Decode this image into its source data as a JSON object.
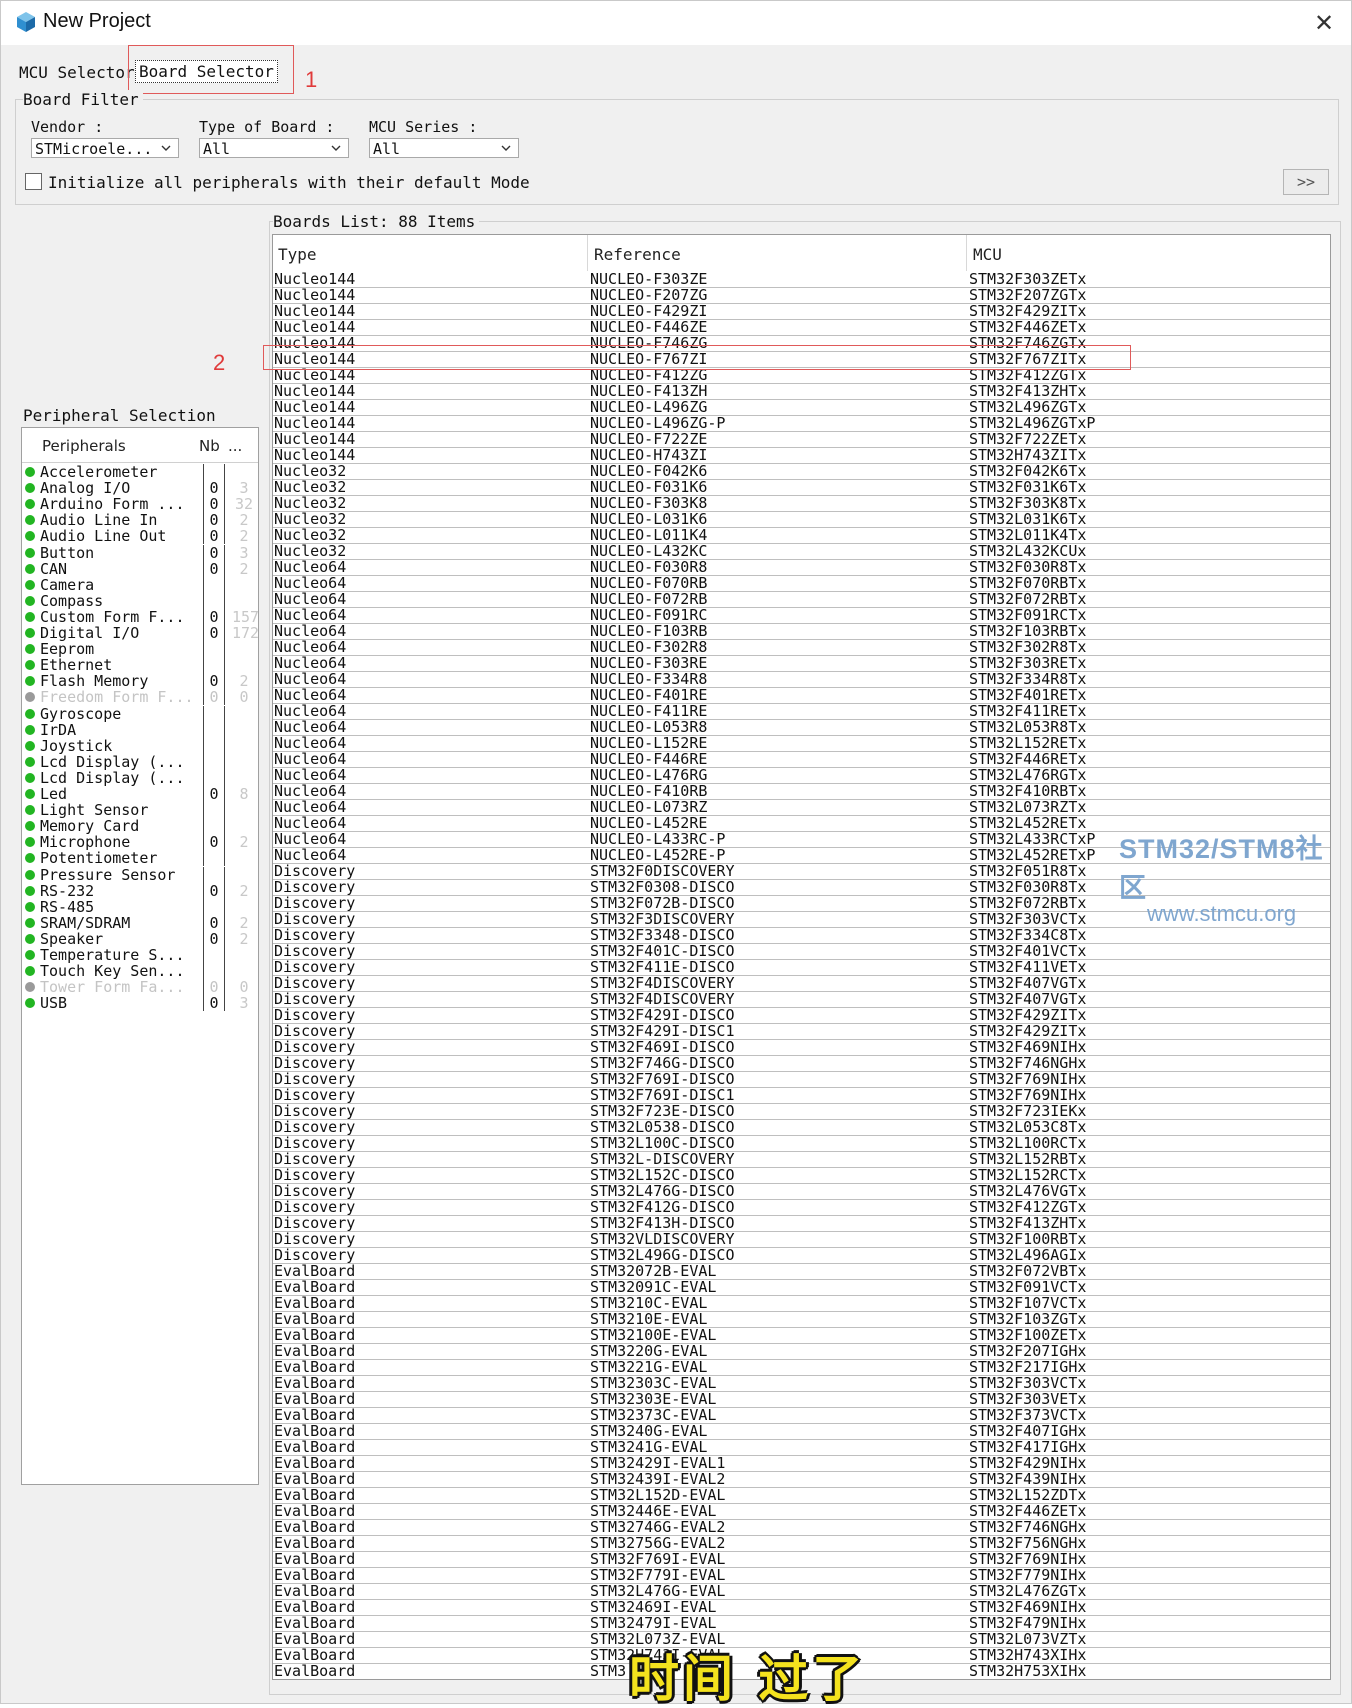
{
  "window": {
    "title": "New Project",
    "close_label": "✕"
  },
  "tabs": {
    "mcu_selector": "MCU Selector",
    "board_selector": "Board Selector"
  },
  "annotations": {
    "one": "1",
    "two": "2"
  },
  "board_filter": {
    "title": "Board Filter",
    "vendor_label": "Vendor :",
    "vendor_value": "STMicroele...",
    "type_label": "Type of Board :",
    "type_value": "All",
    "series_label": "MCU Series :",
    "series_value": "All",
    "init_checkbox_label": "Initialize all peripherals with their default Mode",
    "init_checked": false,
    "expand_button": ">>"
  },
  "peripheral_selection": {
    "title": "Peripheral Selection",
    "headers": [
      "Peripherals",
      "Nb",
      "..."
    ],
    "items": [
      {
        "name": "Accelerometer",
        "nb": "",
        "max": "",
        "enabled": true
      },
      {
        "name": "Analog I/O",
        "nb": "0",
        "max": "3",
        "enabled": true
      },
      {
        "name": "Arduino Form ...",
        "nb": "0",
        "max": "32",
        "enabled": true
      },
      {
        "name": "Audio Line In",
        "nb": "0",
        "max": "2",
        "enabled": true
      },
      {
        "name": "Audio Line Out",
        "nb": "0",
        "max": "2",
        "enabled": true
      },
      {
        "name": "Button",
        "nb": "0",
        "max": "3",
        "enabled": true
      },
      {
        "name": "CAN",
        "nb": "0",
        "max": "2",
        "enabled": true
      },
      {
        "name": "Camera",
        "nb": "",
        "max": "",
        "enabled": true
      },
      {
        "name": "Compass",
        "nb": "",
        "max": "",
        "enabled": true
      },
      {
        "name": "Custom Form F...",
        "nb": "0",
        "max": "157",
        "enabled": true
      },
      {
        "name": "Digital I/O",
        "nb": "0",
        "max": "172",
        "enabled": true
      },
      {
        "name": "Eeprom",
        "nb": "",
        "max": "",
        "enabled": true
      },
      {
        "name": "Ethernet",
        "nb": "",
        "max": "",
        "enabled": true
      },
      {
        "name": "Flash Memory",
        "nb": "0",
        "max": "2",
        "enabled": true
      },
      {
        "name": "Freedom Form F...",
        "nb": "0",
        "max": "0",
        "enabled": false
      },
      {
        "name": "Gyroscope",
        "nb": "",
        "max": "",
        "enabled": true
      },
      {
        "name": "IrDA",
        "nb": "",
        "max": "",
        "enabled": true
      },
      {
        "name": "Joystick",
        "nb": "",
        "max": "",
        "enabled": true
      },
      {
        "name": "Lcd Display (...",
        "nb": "",
        "max": "",
        "enabled": true
      },
      {
        "name": "Lcd Display (...",
        "nb": "",
        "max": "",
        "enabled": true
      },
      {
        "name": "Led",
        "nb": "0",
        "max": "8",
        "enabled": true
      },
      {
        "name": "Light Sensor",
        "nb": "",
        "max": "",
        "enabled": true
      },
      {
        "name": "Memory Card",
        "nb": "",
        "max": "",
        "enabled": true
      },
      {
        "name": "Microphone",
        "nb": "0",
        "max": "2",
        "enabled": true
      },
      {
        "name": "Potentiometer",
        "nb": "",
        "max": "",
        "enabled": true
      },
      {
        "name": "Pressure Sensor",
        "nb": "",
        "max": "",
        "enabled": true
      },
      {
        "name": "RS-232",
        "nb": "0",
        "max": "2",
        "enabled": true
      },
      {
        "name": "RS-485",
        "nb": "",
        "max": "",
        "enabled": true
      },
      {
        "name": "SRAM/SDRAM",
        "nb": "0",
        "max": "2",
        "enabled": true
      },
      {
        "name": "Speaker",
        "nb": "0",
        "max": "2",
        "enabled": true
      },
      {
        "name": "Temperature S...",
        "nb": "",
        "max": "",
        "enabled": true
      },
      {
        "name": "Touch Key Sen...",
        "nb": "",
        "max": "",
        "enabled": true
      },
      {
        "name": "Tower Form Fa...",
        "nb": "0",
        "max": "0",
        "enabled": false
      },
      {
        "name": "USB",
        "nb": "0",
        "max": "3",
        "enabled": true
      }
    ]
  },
  "boards_list": {
    "title": "Boards List: 88 Items",
    "headers": [
      "Type",
      "Reference",
      "MCU"
    ],
    "rows": [
      [
        "Nucleo144",
        "NUCLEO-F303ZE",
        "STM32F303ZETx"
      ],
      [
        "Nucleo144",
        "NUCLEO-F207ZG",
        "STM32F207ZGTx"
      ],
      [
        "Nucleo144",
        "NUCLEO-F429ZI",
        "STM32F429ZITx"
      ],
      [
        "Nucleo144",
        "NUCLEO-F446ZE",
        "STM32F446ZETx"
      ],
      [
        "Nucleo144",
        "NUCLEO-F746ZG",
        "STM32F746ZGTx"
      ],
      [
        "Nucleo144",
        "NUCLEO-F767ZI",
        "STM32F767ZITx"
      ],
      [
        "Nucleo144",
        "NUCLEO-F412ZG",
        "STM32F412ZGTx"
      ],
      [
        "Nucleo144",
        "NUCLEO-F413ZH",
        "STM32F413ZHTx"
      ],
      [
        "Nucleo144",
        "NUCLEO-L496ZG",
        "STM32L496ZGTx"
      ],
      [
        "Nucleo144",
        "NUCLEO-L496ZG-P",
        "STM32L496ZGTxP"
      ],
      [
        "Nucleo144",
        "NUCLEO-F722ZE",
        "STM32F722ZETx"
      ],
      [
        "Nucleo144",
        "NUCLEO-H743ZI",
        "STM32H743ZITx"
      ],
      [
        "Nucleo32",
        "NUCLEO-F042K6",
        "STM32F042K6Tx"
      ],
      [
        "Nucleo32",
        "NUCLEO-F031K6",
        "STM32F031K6Tx"
      ],
      [
        "Nucleo32",
        "NUCLEO-F303K8",
        "STM32F303K8Tx"
      ],
      [
        "Nucleo32",
        "NUCLEO-L031K6",
        "STM32L031K6Tx"
      ],
      [
        "Nucleo32",
        "NUCLEO-L011K4",
        "STM32L011K4Tx"
      ],
      [
        "Nucleo32",
        "NUCLEO-L432KC",
        "STM32L432KCUx"
      ],
      [
        "Nucleo64",
        "NUCLEO-F030R8",
        "STM32F030R8Tx"
      ],
      [
        "Nucleo64",
        "NUCLEO-F070RB",
        "STM32F070RBTx"
      ],
      [
        "Nucleo64",
        "NUCLEO-F072RB",
        "STM32F072RBTx"
      ],
      [
        "Nucleo64",
        "NUCLEO-F091RC",
        "STM32F091RCTx"
      ],
      [
        "Nucleo64",
        "NUCLEO-F103RB",
        "STM32F103RBTx"
      ],
      [
        "Nucleo64",
        "NUCLEO-F302R8",
        "STM32F302R8Tx"
      ],
      [
        "Nucleo64",
        "NUCLEO-F303RE",
        "STM32F303RETx"
      ],
      [
        "Nucleo64",
        "NUCLEO-F334R8",
        "STM32F334R8Tx"
      ],
      [
        "Nucleo64",
        "NUCLEO-F401RE",
        "STM32F401RETx"
      ],
      [
        "Nucleo64",
        "NUCLEO-F411RE",
        "STM32F411RETx"
      ],
      [
        "Nucleo64",
        "NUCLEO-L053R8",
        "STM32L053R8Tx"
      ],
      [
        "Nucleo64",
        "NUCLEO-L152RE",
        "STM32L152RETx"
      ],
      [
        "Nucleo64",
        "NUCLEO-F446RE",
        "STM32F446RETx"
      ],
      [
        "Nucleo64",
        "NUCLEO-L476RG",
        "STM32L476RGTx"
      ],
      [
        "Nucleo64",
        "NUCLEO-F410RB",
        "STM32F410RBTx"
      ],
      [
        "Nucleo64",
        "NUCLEO-L073RZ",
        "STM32L073RZTx"
      ],
      [
        "Nucleo64",
        "NUCLEO-L452RE",
        "STM32L452RETx"
      ],
      [
        "Nucleo64",
        "NUCLEO-L433RC-P",
        "STM32L433RCTxP"
      ],
      [
        "Nucleo64",
        "NUCLEO-L452RE-P",
        "STM32L452RETxP"
      ],
      [
        "Discovery",
        "STM32F0DISCOVERY",
        "STM32F051R8Tx"
      ],
      [
        "Discovery",
        "STM32F0308-DISCO",
        "STM32F030R8Tx"
      ],
      [
        "Discovery",
        "STM32F072B-DISCO",
        "STM32F072RBTx"
      ],
      [
        "Discovery",
        "STM32F3DISCOVERY",
        "STM32F303VCTx"
      ],
      [
        "Discovery",
        "STM32F3348-DISCO",
        "STM32F334C8Tx"
      ],
      [
        "Discovery",
        "STM32F401C-DISCO",
        "STM32F401VCTx"
      ],
      [
        "Discovery",
        "STM32F411E-DISCO",
        "STM32F411VETx"
      ],
      [
        "Discovery",
        "STM32F4DISCOVERY",
        "STM32F407VGTx"
      ],
      [
        "Discovery",
        "STM32F4DISCOVERY",
        "STM32F407VGTx"
      ],
      [
        "Discovery",
        "STM32F429I-DISCO",
        "STM32F429ZITx"
      ],
      [
        "Discovery",
        "STM32F429I-DISC1",
        "STM32F429ZITx"
      ],
      [
        "Discovery",
        "STM32F469I-DISCO",
        "STM32F469NIHx"
      ],
      [
        "Discovery",
        "STM32F746G-DISCO",
        "STM32F746NGHx"
      ],
      [
        "Discovery",
        "STM32F769I-DISCO",
        "STM32F769NIHx"
      ],
      [
        "Discovery",
        "STM32F769I-DISC1",
        "STM32F769NIHx"
      ],
      [
        "Discovery",
        "STM32F723E-DISCO",
        "STM32F723IEKx"
      ],
      [
        "Discovery",
        "STM32L0538-DISCO",
        "STM32L053C8Tx"
      ],
      [
        "Discovery",
        "STM32L100C-DISCO",
        "STM32L100RCTx"
      ],
      [
        "Discovery",
        "STM32L-DISCOVERY",
        "STM32L152RBTx"
      ],
      [
        "Discovery",
        "STM32L152C-DISCO",
        "STM32L152RCTx"
      ],
      [
        "Discovery",
        "STM32L476G-DISCO",
        "STM32L476VGTx"
      ],
      [
        "Discovery",
        "STM32F412G-DISCO",
        "STM32F412ZGTx"
      ],
      [
        "Discovery",
        "STM32F413H-DISCO",
        "STM32F413ZHTx"
      ],
      [
        "Discovery",
        "STM32VLDISCOVERY",
        "STM32F100RBTx"
      ],
      [
        "Discovery",
        "STM32L496G-DISCO",
        "STM32L496AGIx"
      ],
      [
        "EvalBoard",
        "STM32072B-EVAL",
        "STM32F072VBTx"
      ],
      [
        "EvalBoard",
        "STM32091C-EVAL",
        "STM32F091VCTx"
      ],
      [
        "EvalBoard",
        "STM3210C-EVAL",
        "STM32F107VCTx"
      ],
      [
        "EvalBoard",
        "STM3210E-EVAL",
        "STM32F103ZGTx"
      ],
      [
        "EvalBoard",
        "STM32100E-EVAL",
        "STM32F100ZETx"
      ],
      [
        "EvalBoard",
        "STM3220G-EVAL",
        "STM32F207IGHx"
      ],
      [
        "EvalBoard",
        "STM3221G-EVAL",
        "STM32F217IGHx"
      ],
      [
        "EvalBoard",
        "STM32303C-EVAL",
        "STM32F303VCTx"
      ],
      [
        "EvalBoard",
        "STM32303E-EVAL",
        "STM32F303VETx"
      ],
      [
        "EvalBoard",
        "STM32373C-EVAL",
        "STM32F373VCTx"
      ],
      [
        "EvalBoard",
        "STM3240G-EVAL",
        "STM32F407IGHx"
      ],
      [
        "EvalBoard",
        "STM3241G-EVAL",
        "STM32F417IGHx"
      ],
      [
        "EvalBoard",
        "STM32429I-EVAL1",
        "STM32F429NIHx"
      ],
      [
        "EvalBoard",
        "STM32439I-EVAL2",
        "STM32F439NIHx"
      ],
      [
        "EvalBoard",
        "STM32L152D-EVAL",
        "STM32L152ZDTx"
      ],
      [
        "EvalBoard",
        "STM32446E-EVAL",
        "STM32F446ZETx"
      ],
      [
        "EvalBoard",
        "STM32746G-EVAL2",
        "STM32F746NGHx"
      ],
      [
        "EvalBoard",
        "STM32756G-EVAL2",
        "STM32F756NGHx"
      ],
      [
        "EvalBoard",
        "STM32F769I-EVAL",
        "STM32F769NIHx"
      ],
      [
        "EvalBoard",
        "STM32F779I-EVAL",
        "STM32F779NIHx"
      ],
      [
        "EvalBoard",
        "STM32L476G-EVAL",
        "STM32L476ZGTx"
      ],
      [
        "EvalBoard",
        "STM32469I-EVAL",
        "STM32F469NIHx"
      ],
      [
        "EvalBoard",
        "STM32479I-EVAL",
        "STM32F479NIHx"
      ],
      [
        "EvalBoard",
        "STM32L073Z-EVAL",
        "STM32L073VZTx"
      ],
      [
        "EvalBoard",
        "STM32H743I-EVAL",
        "STM32H743XIHx"
      ],
      [
        "EvalBoard",
        "STM3...",
        "STM32H753XIHx"
      ]
    ],
    "highlighted_row_index": 5
  },
  "watermark": {
    "line1": "STM32/STM8社区",
    "line2": "www.stmcu.org"
  },
  "caption": "时间 过了",
  "colors": {
    "status_green": "#22b522",
    "status_gray": "#9a9a9a",
    "annotation_red": "#e05a5a",
    "caption_yellow": "#f4e21e"
  }
}
